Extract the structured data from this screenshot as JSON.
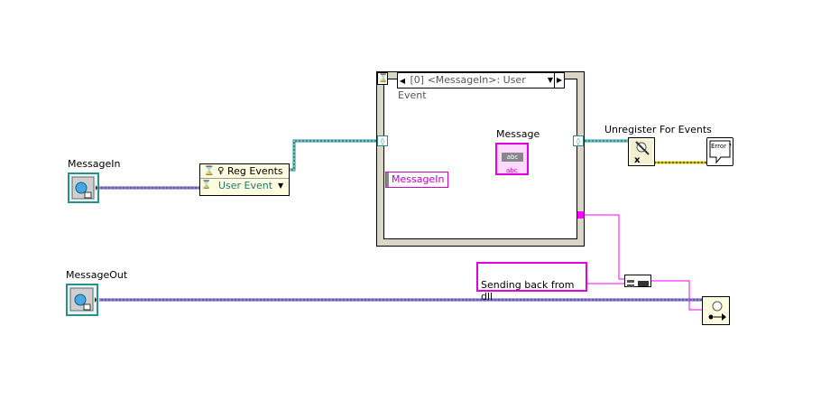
{
  "labels": {
    "message_in": "MessageIn",
    "message_out": "MessageOut",
    "message": "Message",
    "unregister": "Unregister For Events"
  },
  "reg_events": {
    "title": "Reg Events",
    "item": "User Event"
  },
  "event_structure": {
    "selector": "[0] <MessageIn>: User Event",
    "data_node_label": "MessageIn"
  },
  "string_constant": "Sending back from dll",
  "string_indicator": {
    "badge_top": "abc",
    "badge_bottom": "abc"
  },
  "error_icon_text": "Error ?!",
  "colors": {
    "event_wire": "#2a8f8f",
    "string_wire": "#ff00ff",
    "error_wire": "#d4c400",
    "frame_border": "#d9d6c6",
    "user_event_text": "#1a7a7a"
  }
}
